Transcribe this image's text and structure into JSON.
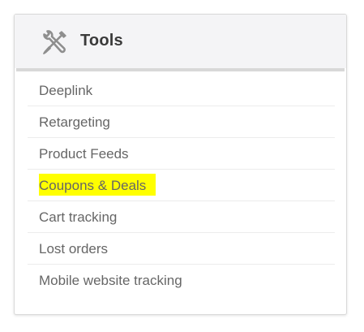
{
  "panel": {
    "title": "Tools",
    "icon": "wrench-screwdriver-icon"
  },
  "menu": {
    "items": [
      {
        "label": "Deeplink",
        "highlighted": false
      },
      {
        "label": "Retargeting",
        "highlighted": false
      },
      {
        "label": "Product Feeds",
        "highlighted": false
      },
      {
        "label": "Coupons & Deals",
        "highlighted": true
      },
      {
        "label": "Cart tracking",
        "highlighted": false
      },
      {
        "label": "Lost orders",
        "highlighted": false
      },
      {
        "label": "Mobile website tracking",
        "highlighted": false
      }
    ]
  },
  "colors": {
    "highlight": "#ffff00",
    "header_bg": "#f4f4f6",
    "text": "#666666",
    "title": "#3a3a3a"
  }
}
